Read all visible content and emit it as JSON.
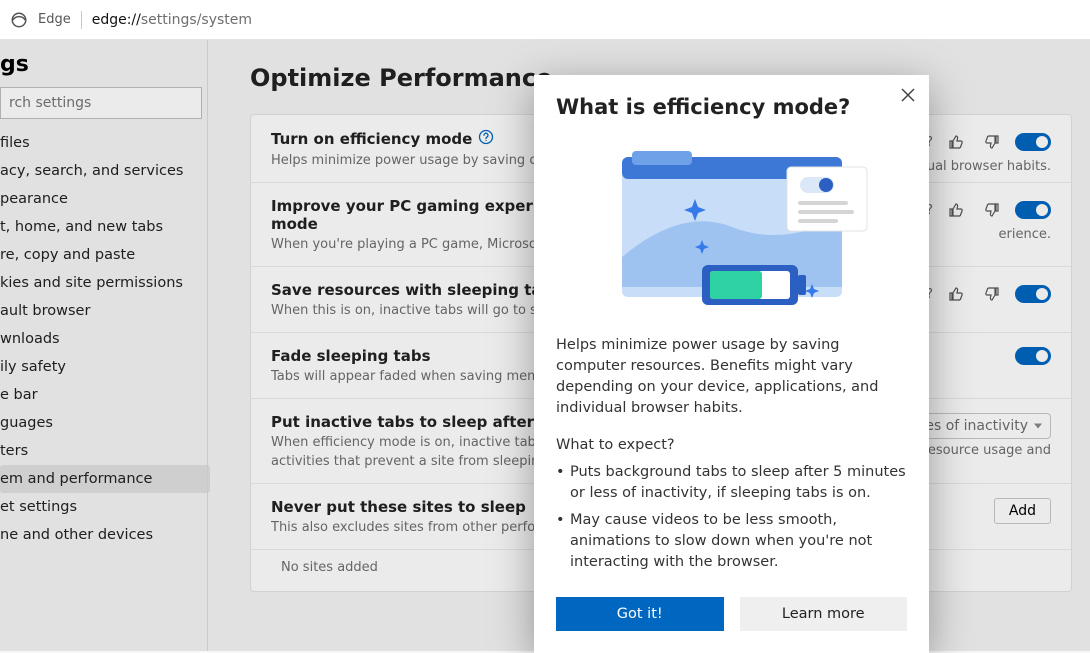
{
  "chrome": {
    "product": "Edge",
    "url_prefix": "edge://",
    "url_path": "settings/system"
  },
  "settings_title_fragment": "gs",
  "search": {
    "placeholder": "rch settings"
  },
  "nav": [
    {
      "label": "files"
    },
    {
      "label": "acy, search, and services"
    },
    {
      "label": "pearance"
    },
    {
      "label": "t, home, and new tabs"
    },
    {
      "label": "re, copy and paste"
    },
    {
      "label": "kies and site permissions"
    },
    {
      "label": "ault browser"
    },
    {
      "label": "wnloads"
    },
    {
      "label": "ily safety"
    },
    {
      "label": "e bar"
    },
    {
      "label": "guages"
    },
    {
      "label": "ters"
    },
    {
      "label": "em and performance",
      "selected": true
    },
    {
      "label": "et settings"
    },
    {
      "label": "ne and other devices"
    }
  ],
  "main": {
    "heading": "Optimize Performance",
    "rows": [
      {
        "title": "Turn on efficiency mode",
        "desc": "Helps minimize power usage by saving compu",
        "info": true,
        "right_text_a": "e?",
        "right_text_b": "d individual browser habits.",
        "toggle": true,
        "thumbs": true
      },
      {
        "title": "Improve your PC gaming experience w",
        "title2": "mode",
        "desc": "When you're playing a PC game, Microsoft Ed",
        "right_text_a": "g?",
        "right_text_b": "erience.",
        "toggle": true,
        "thumbs": true
      },
      {
        "title": "Save resources with sleeping tabs",
        "desc": "When this is on, inactive tabs will go to sleep a",
        "right_text_a": "s?",
        "toggle": true,
        "thumbs": true
      },
      {
        "title": "Fade sleeping tabs",
        "desc": "Tabs will appear faded when saving memory a",
        "toggle": true
      },
      {
        "title": "Put inactive tabs to sleep after the spe",
        "desc": "When efficiency mode is on, inactive tabs will",
        "desc2": "activities that prevent a site from sleeping (e.g",
        "dropdown": "utes of inactivity",
        "right_text_b": "esource usage and"
      },
      {
        "title": "Never put these sites to sleep",
        "desc": "This also excludes sites from other performanc",
        "add": "Add"
      }
    ],
    "sites_empty": "No sites added"
  },
  "modal": {
    "title": "What is efficiency mode?",
    "body": "Helps minimize power usage by saving computer resources. Benefits might vary depending on your device, applications, and individual browser habits.",
    "subhead": "What to expect?",
    "bullets": [
      "Puts background tabs to sleep after 5 minutes or less of inactivity, if sleeping tabs is on.",
      "May cause videos to be less smooth, animations to slow down when you're not interacting with the browser."
    ],
    "primary": "Got it!",
    "secondary": "Learn more"
  }
}
